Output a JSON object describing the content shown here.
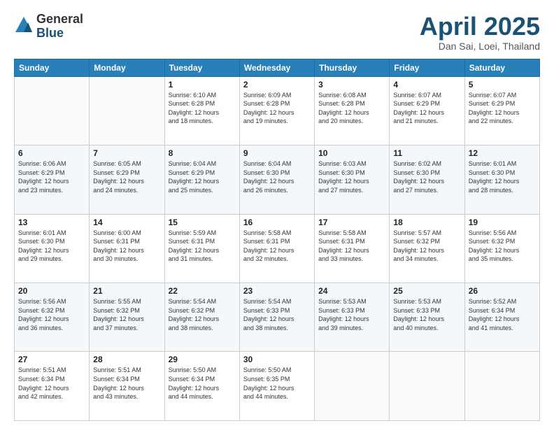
{
  "header": {
    "logo_general": "General",
    "logo_blue": "Blue",
    "main_title": "April 2025",
    "subtitle": "Dan Sai, Loei, Thailand"
  },
  "calendar": {
    "days_of_week": [
      "Sunday",
      "Monday",
      "Tuesday",
      "Wednesday",
      "Thursday",
      "Friday",
      "Saturday"
    ],
    "weeks": [
      [
        {
          "day": "",
          "detail": ""
        },
        {
          "day": "",
          "detail": ""
        },
        {
          "day": "1",
          "detail": "Sunrise: 6:10 AM\nSunset: 6:28 PM\nDaylight: 12 hours\nand 18 minutes."
        },
        {
          "day": "2",
          "detail": "Sunrise: 6:09 AM\nSunset: 6:28 PM\nDaylight: 12 hours\nand 19 minutes."
        },
        {
          "day": "3",
          "detail": "Sunrise: 6:08 AM\nSunset: 6:28 PM\nDaylight: 12 hours\nand 20 minutes."
        },
        {
          "day": "4",
          "detail": "Sunrise: 6:07 AM\nSunset: 6:29 PM\nDaylight: 12 hours\nand 21 minutes."
        },
        {
          "day": "5",
          "detail": "Sunrise: 6:07 AM\nSunset: 6:29 PM\nDaylight: 12 hours\nand 22 minutes."
        }
      ],
      [
        {
          "day": "6",
          "detail": "Sunrise: 6:06 AM\nSunset: 6:29 PM\nDaylight: 12 hours\nand 23 minutes."
        },
        {
          "day": "7",
          "detail": "Sunrise: 6:05 AM\nSunset: 6:29 PM\nDaylight: 12 hours\nand 24 minutes."
        },
        {
          "day": "8",
          "detail": "Sunrise: 6:04 AM\nSunset: 6:29 PM\nDaylight: 12 hours\nand 25 minutes."
        },
        {
          "day": "9",
          "detail": "Sunrise: 6:04 AM\nSunset: 6:30 PM\nDaylight: 12 hours\nand 26 minutes."
        },
        {
          "day": "10",
          "detail": "Sunrise: 6:03 AM\nSunset: 6:30 PM\nDaylight: 12 hours\nand 27 minutes."
        },
        {
          "day": "11",
          "detail": "Sunrise: 6:02 AM\nSunset: 6:30 PM\nDaylight: 12 hours\nand 27 minutes."
        },
        {
          "day": "12",
          "detail": "Sunrise: 6:01 AM\nSunset: 6:30 PM\nDaylight: 12 hours\nand 28 minutes."
        }
      ],
      [
        {
          "day": "13",
          "detail": "Sunrise: 6:01 AM\nSunset: 6:30 PM\nDaylight: 12 hours\nand 29 minutes."
        },
        {
          "day": "14",
          "detail": "Sunrise: 6:00 AM\nSunset: 6:31 PM\nDaylight: 12 hours\nand 30 minutes."
        },
        {
          "day": "15",
          "detail": "Sunrise: 5:59 AM\nSunset: 6:31 PM\nDaylight: 12 hours\nand 31 minutes."
        },
        {
          "day": "16",
          "detail": "Sunrise: 5:58 AM\nSunset: 6:31 PM\nDaylight: 12 hours\nand 32 minutes."
        },
        {
          "day": "17",
          "detail": "Sunrise: 5:58 AM\nSunset: 6:31 PM\nDaylight: 12 hours\nand 33 minutes."
        },
        {
          "day": "18",
          "detail": "Sunrise: 5:57 AM\nSunset: 6:32 PM\nDaylight: 12 hours\nand 34 minutes."
        },
        {
          "day": "19",
          "detail": "Sunrise: 5:56 AM\nSunset: 6:32 PM\nDaylight: 12 hours\nand 35 minutes."
        }
      ],
      [
        {
          "day": "20",
          "detail": "Sunrise: 5:56 AM\nSunset: 6:32 PM\nDaylight: 12 hours\nand 36 minutes."
        },
        {
          "day": "21",
          "detail": "Sunrise: 5:55 AM\nSunset: 6:32 PM\nDaylight: 12 hours\nand 37 minutes."
        },
        {
          "day": "22",
          "detail": "Sunrise: 5:54 AM\nSunset: 6:32 PM\nDaylight: 12 hours\nand 38 minutes."
        },
        {
          "day": "23",
          "detail": "Sunrise: 5:54 AM\nSunset: 6:33 PM\nDaylight: 12 hours\nand 38 minutes."
        },
        {
          "day": "24",
          "detail": "Sunrise: 5:53 AM\nSunset: 6:33 PM\nDaylight: 12 hours\nand 39 minutes."
        },
        {
          "day": "25",
          "detail": "Sunrise: 5:53 AM\nSunset: 6:33 PM\nDaylight: 12 hours\nand 40 minutes."
        },
        {
          "day": "26",
          "detail": "Sunrise: 5:52 AM\nSunset: 6:34 PM\nDaylight: 12 hours\nand 41 minutes."
        }
      ],
      [
        {
          "day": "27",
          "detail": "Sunrise: 5:51 AM\nSunset: 6:34 PM\nDaylight: 12 hours\nand 42 minutes."
        },
        {
          "day": "28",
          "detail": "Sunrise: 5:51 AM\nSunset: 6:34 PM\nDaylight: 12 hours\nand 43 minutes."
        },
        {
          "day": "29",
          "detail": "Sunrise: 5:50 AM\nSunset: 6:34 PM\nDaylight: 12 hours\nand 44 minutes."
        },
        {
          "day": "30",
          "detail": "Sunrise: 5:50 AM\nSunset: 6:35 PM\nDaylight: 12 hours\nand 44 minutes."
        },
        {
          "day": "",
          "detail": ""
        },
        {
          "day": "",
          "detail": ""
        },
        {
          "day": "",
          "detail": ""
        }
      ]
    ]
  }
}
